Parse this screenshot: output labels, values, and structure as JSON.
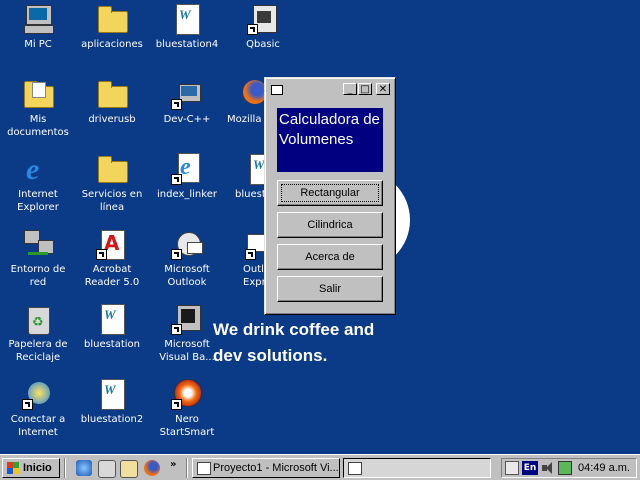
{
  "desktop": {
    "icons": [
      {
        "label": "Mi PC",
        "icon": "my-computer-icon"
      },
      {
        "label": "aplicaciones",
        "icon": "folder-icon"
      },
      {
        "label": "bluestation4",
        "icon": "word-document-icon"
      },
      {
        "label": "Qbasic",
        "icon": "qbasic-shortcut-icon"
      },
      {
        "label": "Mis documentos",
        "icon": "my-documents-icon"
      },
      {
        "label": "driverusb",
        "icon": "folder-icon"
      },
      {
        "label": "Dev-C++",
        "icon": "devcpp-shortcut-icon"
      },
      {
        "label": "Mozilla",
        "icon": "mozilla-firefox-icon"
      },
      {
        "label": "Internet Explorer",
        "icon": "internet-explorer-icon"
      },
      {
        "label": "Servicios en línea",
        "icon": "folder-icon"
      },
      {
        "label": "index_linker",
        "icon": "internet-explorer-icon"
      },
      {
        "label": "bluest",
        "icon": "word-document-icon"
      },
      {
        "label": "Entorno de red",
        "icon": "network-neighborhood-icon"
      },
      {
        "label": "Acrobat Reader 5.0",
        "icon": "acrobat-reader-icon"
      },
      {
        "label": "Microsoft Outlook",
        "icon": "outlook-icon"
      },
      {
        "label": "Outlo Expr",
        "icon": "outlook-express-icon"
      },
      {
        "label": "Papelera de Reciclaje",
        "icon": "recycle-bin-icon"
      },
      {
        "label": "bluestation",
        "icon": "word-document-icon"
      },
      {
        "label": "Microsoft Visual Ba...",
        "icon": "visual-basic-icon"
      },
      {
        "label": "Conectar a Internet",
        "icon": "connect-internet-icon"
      },
      {
        "label": "bluestation2",
        "icon": "word-document-icon"
      },
      {
        "label": "Nero StartSmart",
        "icon": "nero-icon"
      }
    ],
    "wallpaper_line1": "We drink coffee and",
    "wallpaper_line2": "dev solutions."
  },
  "window": {
    "title": "",
    "minimize_glyph": "_",
    "maximize_glyph": "□",
    "close_glyph": "✕",
    "label": "Calculadora de Volumenes",
    "buttons": [
      "Rectangular",
      "Cilindrica",
      "Acerca de",
      "Salir"
    ]
  },
  "taskbar": {
    "start_label": "Inicio",
    "overflow_glyph": "»",
    "tasks": [
      "Proyecto1 - Microsoft Vi...",
      ""
    ],
    "lang": "En",
    "clock": "04:49 a.m."
  },
  "colors": {
    "desktop_bg": "#0b3a86",
    "label_bg": "#000080",
    "window_face": "#c0c0c0"
  }
}
